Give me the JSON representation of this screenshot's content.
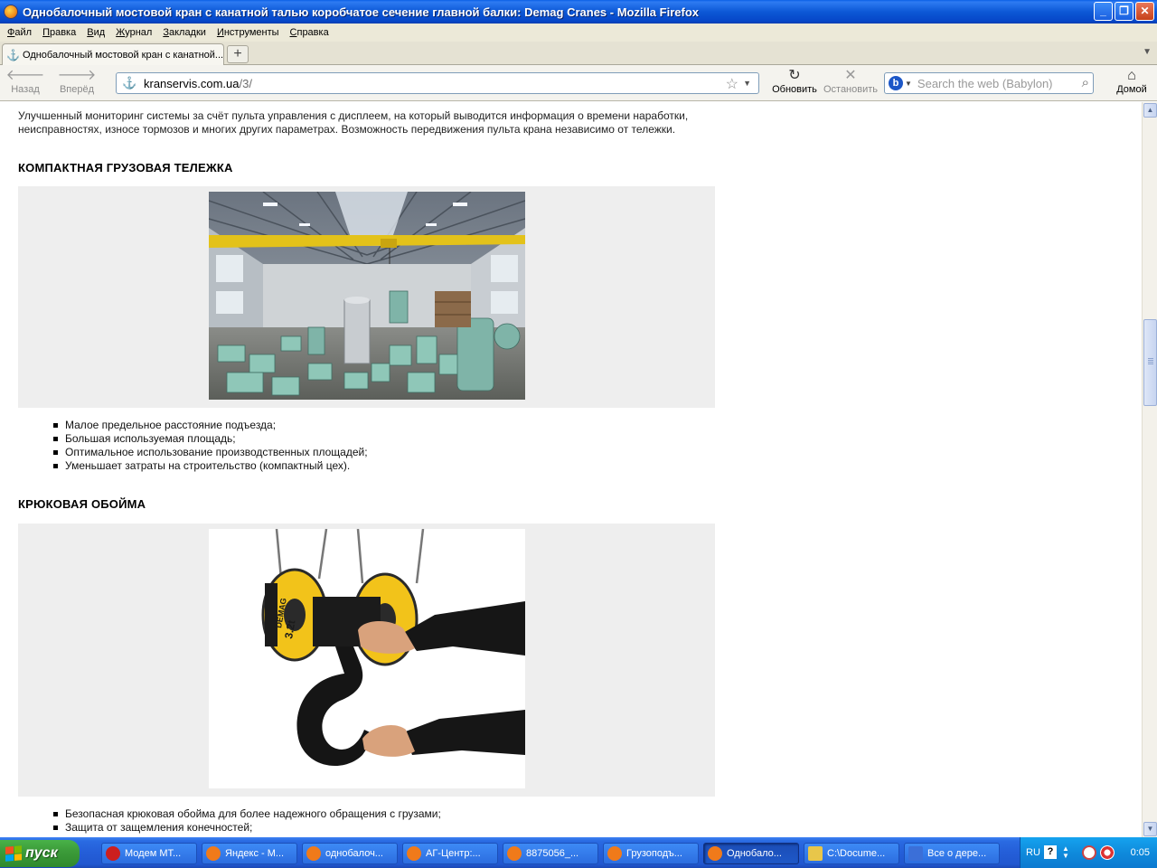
{
  "window": {
    "title": "Однобалочный мостовой кран с канатной талью коробчатое сечение главной балки: Demag Cranes - Mozilla Firefox"
  },
  "menu": {
    "items": [
      {
        "first": "Ф",
        "rest": "айл"
      },
      {
        "first": "П",
        "rest": "равка"
      },
      {
        "first": "В",
        "rest": "ид"
      },
      {
        "first": "Ж",
        "rest": "урнал"
      },
      {
        "first": "З",
        "rest": "акладки"
      },
      {
        "first": "И",
        "rest": "нструменты"
      },
      {
        "first": "С",
        "rest": "правка"
      }
    ]
  },
  "tabs": {
    "active_label": "Однобалочный мостовой кран с канатной...",
    "new_tab": "+"
  },
  "nav": {
    "back": "Назад",
    "forward": "Вперёд",
    "reload": "Обновить",
    "stop": "Остановить",
    "home": "Домой",
    "url_host": "kranservis.com.ua",
    "url_path": "/3/",
    "search_placeholder": "Search the web (Babylon)"
  },
  "page": {
    "intro": "Улучшенный мониторинг системы за счёт пульта управления с дисплеем, на который выводится информация о времени наработки, неисправностях, износе тормозов и многих других параметрах. Возможность передвижения пульта крана независимо от тележки.",
    "section1": {
      "heading": "КОМПАКТНАЯ ГРУЗОВАЯ ТЕЛЕЖКА",
      "bullets": [
        "Малое предельное расстояние подъезда;",
        "Большая используемая площадь;",
        "Оптимальное использование производственных площадей;",
        "Уменьшает затраты на строительство (компактный цех)."
      ]
    },
    "section2": {
      "heading": "КРЮКОВАЯ ОБОЙМА",
      "bullets": [
        "Безопасная крюковая обойма для более надежного обращения с грузами;",
        "Защита от защемления конечностей;"
      ],
      "block_brand": "DEMAG",
      "block_rating": "3.2t"
    }
  },
  "taskbar": {
    "start": "пуск",
    "tasks": [
      {
        "label": "Модем МТ...",
        "color": "#cc1f1f"
      },
      {
        "label": "Яндекс - М...",
        "color": "#f07a1a"
      },
      {
        "label": "однобалоч...",
        "color": "#f07a1a"
      },
      {
        "label": "АГ-Центр:...",
        "color": "#f07a1a"
      },
      {
        "label": "8875056_...",
        "color": "#f07a1a"
      },
      {
        "label": "Грузоподъ...",
        "color": "#f07a1a"
      },
      {
        "label": "Однобало...",
        "color": "#f07a1a"
      },
      {
        "label": "C:\\Docume...",
        "color": "#e8c64a"
      },
      {
        "label": "Все о дере...",
        "color": "#3b6fd8"
      }
    ],
    "lang": "RU",
    "help": "?",
    "clock": "0:05"
  }
}
